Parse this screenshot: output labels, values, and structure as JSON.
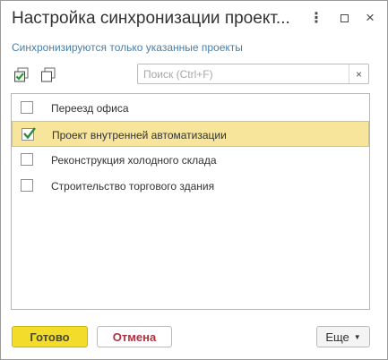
{
  "window": {
    "title": "Настройка синхронизации проект...",
    "more_glyph": "⋮",
    "close_glyph": "×"
  },
  "subtitle": "Синхронизируются только указанные проекты",
  "toolbar": {
    "check_all_icon": "check-all-icon",
    "uncheck_all_icon": "uncheck-all-icon"
  },
  "search": {
    "placeholder": "Поиск (Ctrl+F)",
    "value": "",
    "clear_glyph": "×"
  },
  "projects": [
    {
      "label": "Переезд офиса",
      "checked": false,
      "selected": false
    },
    {
      "label": "Проект внутренней автоматизации",
      "checked": true,
      "selected": true
    },
    {
      "label": "Реконструкция холодного склада",
      "checked": false,
      "selected": false
    },
    {
      "label": "Строительство торгового здания",
      "checked": false,
      "selected": false
    }
  ],
  "buttons": {
    "ok": "Готово",
    "cancel": "Отмена",
    "more": "Еще",
    "more_caret": "▼"
  },
  "colors": {
    "accent_yellow": "#f4dc2b",
    "selected_row": "#f7e59b",
    "cancel_text": "#b03040",
    "link_blue": "#4a7fa8",
    "check_green": "#2e8b3a"
  }
}
